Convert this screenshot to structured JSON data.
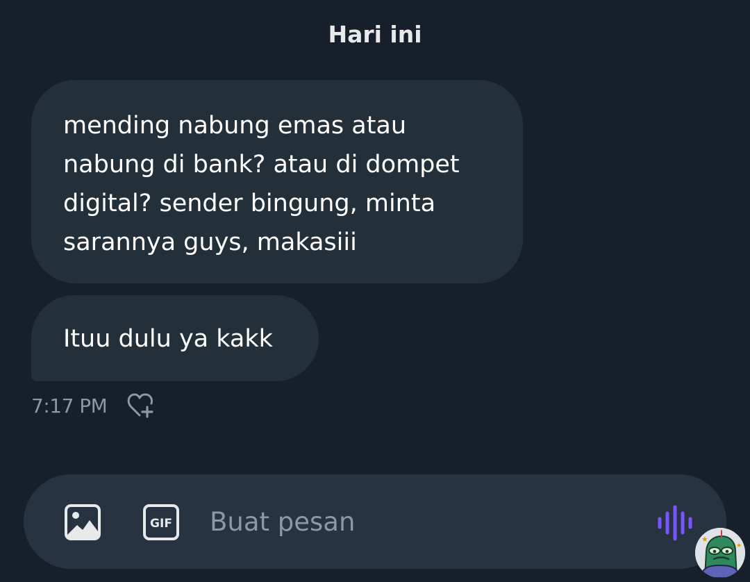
{
  "conversation": {
    "date_separator": "Hari ini",
    "messages": [
      {
        "lines": [
          "mending nabung emas atau",
          "nabung di bank? atau di dompet",
          "digital? sender bingung, minta",
          "sarannya guys, makasiii"
        ]
      },
      {
        "lines": [
          "Ituu dulu ya kakk"
        ]
      }
    ],
    "timestamp": "7:17 PM",
    "reaction_icon": "heart-plus-icon"
  },
  "composer": {
    "placeholder": "Buat pesan",
    "image_icon": "image-icon",
    "gif_icon": "gif-icon",
    "gif_label": "GIF",
    "voice_icon": "voice-waveform-icon"
  },
  "colors": {
    "background": "#17202a",
    "bubble": "#243039",
    "composer": "#273340",
    "muted_text": "#8b98a5",
    "voice_accent": "#7856ff"
  }
}
